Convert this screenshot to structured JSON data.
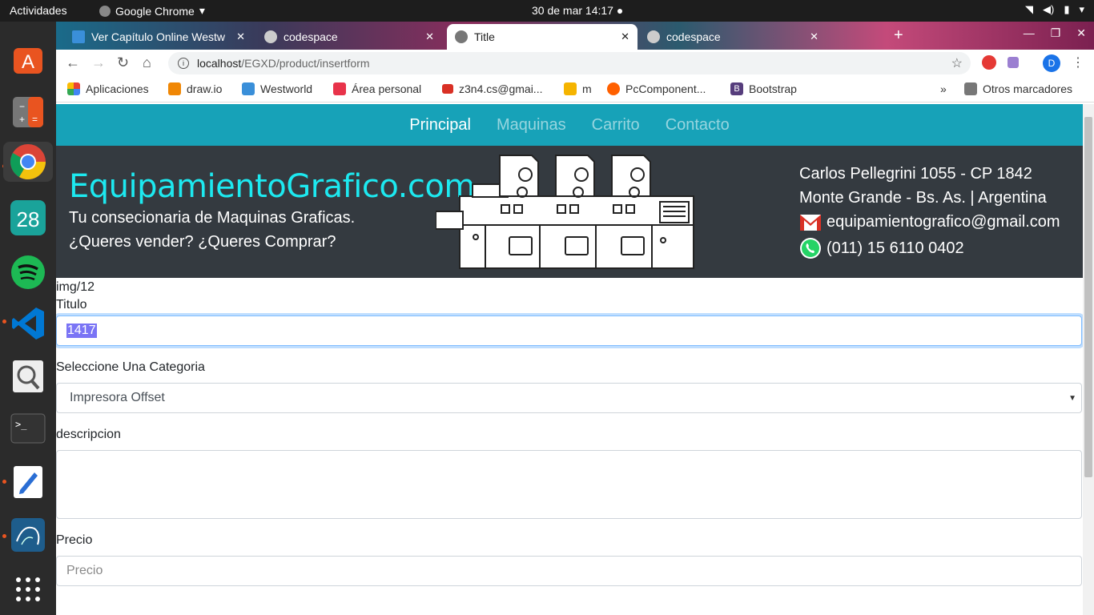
{
  "os": {
    "activities": "Actividades",
    "app_name": "Google Chrome",
    "clock": "30 de mar  14:17",
    "dock_calendar_day": "28"
  },
  "browser": {
    "tabs": [
      {
        "label": "Ver Capítulo Online Westw",
        "active": false
      },
      {
        "label": "codespace",
        "active": false
      },
      {
        "label": "Title",
        "active": true
      },
      {
        "label": "codespace",
        "active": false
      }
    ],
    "url_host": "localhost",
    "url_path": "/EGXD/product/insertform",
    "profile_initial": "D",
    "bookmarks": [
      {
        "label": "Aplicaciones",
        "color": "#e94235"
      },
      {
        "label": "draw.io",
        "color": "#f08705"
      },
      {
        "label": "Westworld",
        "color": "#3a8fd9"
      },
      {
        "label": "Área personal",
        "color": "#e8334a"
      },
      {
        "label": "z3n4.cs@gmai...",
        "color": "#d93025"
      },
      {
        "label": "m",
        "color": "#f5b400"
      },
      {
        "label": "PcComponent...",
        "color": "#ff6000"
      },
      {
        "label": "Bootstrap",
        "color": "#563d7c"
      }
    ],
    "bookmarks_more": "»",
    "other_bookmarks": "Otros marcadores"
  },
  "site": {
    "nav": [
      "Principal",
      "Maquinas",
      "Carrito",
      "Contacto"
    ],
    "brand": "EquipamientoGrafico.com",
    "tagline1": "Tu consecionaria de Maquinas Graficas.",
    "tagline2": "¿Queres vender? ¿Queres Comprar?",
    "address1": "Carlos Pellegrini 1055 - CP 1842",
    "address2": "Monte Grande - Bs. As. | Argentina",
    "email": "equipamientografico@gmail.com",
    "phone": "(011) 15 6110 0402"
  },
  "form": {
    "img_path": "img/12",
    "titulo_label": "Titulo",
    "titulo_value": "1417",
    "categoria_label": "Seleccione Una Categoria",
    "categoria_selected": "Impresora Offset",
    "descripcion_label": "descripcion",
    "descripcion_value": "",
    "precio_label": "Precio",
    "precio_placeholder": "Precio"
  }
}
